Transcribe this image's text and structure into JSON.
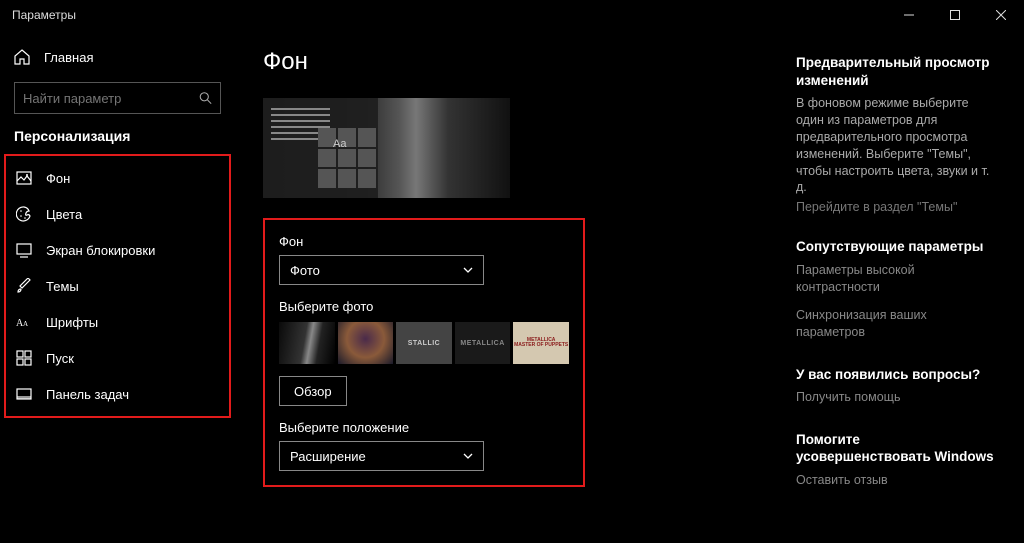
{
  "window": {
    "title": "Параметры"
  },
  "sidebar": {
    "home": "Главная",
    "search_placeholder": "Найти параметр",
    "section": "Персонализация",
    "items": [
      {
        "label": "Фон"
      },
      {
        "label": "Цвета"
      },
      {
        "label": "Экран блокировки"
      },
      {
        "label": "Темы"
      },
      {
        "label": "Шрифты"
      },
      {
        "label": "Пуск"
      },
      {
        "label": "Панель задач"
      }
    ]
  },
  "page": {
    "title": "Фон",
    "bg_label": "Фон",
    "bg_value": "Фото",
    "choose_photo": "Выберите фото",
    "browse": "Обзор",
    "position_label": "Выберите положение",
    "position_value": "Расширение",
    "preview_sample": "Aa",
    "thumb3_text": "STALLIC",
    "thumb4_text": "METALLICA",
    "thumb5_line1": "METALLICA",
    "thumb5_line2": "MASTER OF PUPPETS"
  },
  "right": {
    "preview_heading": "Предварительный просмотр изменений",
    "preview_text": "В фоновом режиме выберите один из параметров для предварительного просмотра изменений. Выберите \"Темы\", чтобы настроить цвета, звуки и т. д.",
    "preview_link": "Перейдите в раздел \"Темы\"",
    "related_heading": "Сопутствующие параметры",
    "related_link1": "Параметры высокой контрастности",
    "related_link2": "Синхронизация ваших параметров",
    "questions_heading": "У вас появились вопросы?",
    "questions_link": "Получить помощь",
    "improve_heading": "Помогите усовершенствовать Windows",
    "improve_link": "Оставить отзыв"
  }
}
